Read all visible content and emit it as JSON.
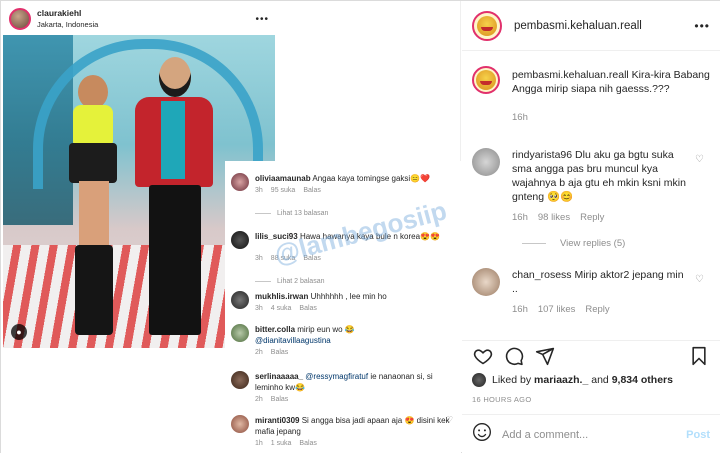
{
  "inner_post": {
    "username": "claurakiehl",
    "location": "Jakarta, Indonesia",
    "comments": [
      {
        "user": "oliviaamaunab",
        "text": "Angaa kaya tomingse gaksi😑❤️",
        "time": "3h",
        "likes": "95 suka",
        "reply": "Balas"
      },
      {
        "more": "Lihat 13 balasan"
      },
      {
        "user": "lilis_suci93",
        "text": "Hawa hawanya kaya bule n korea😍😍",
        "time": "3h",
        "likes": "88 suka",
        "reply": "Balas"
      },
      {
        "more": "Lihat 2 balasan"
      },
      {
        "user": "mukhlis.irwan",
        "text": "Uhhhhhh , lee min ho",
        "time": "3h",
        "likes": "4 suka",
        "reply": "Balas"
      },
      {
        "user": "bitter.colla",
        "text": "mirip eun wo 😂",
        "mention": "@dianitavillaagustina",
        "time": "2h",
        "reply": "Balas"
      },
      {
        "user": "serlinaaaaa_",
        "mention": "@ressymagfiratuf",
        "text": "ie nanaonan si, si leminho kw😂",
        "time": "2h",
        "reply": "Balas"
      },
      {
        "user": "miranti0309",
        "text": "Si angga bisa jadi apaan aja 😍 disini kek mafia jepang",
        "time": "1h",
        "likes": "1 suka",
        "reply": "Balas"
      }
    ],
    "watermark": "@lambegosiip"
  },
  "post": {
    "username": "pembasmi.kehaluan.reall",
    "caption_user": "pembasmi.kehaluan.reall",
    "caption": "Kira-kira Babang Angga mirip siapa nih gaesss.???",
    "caption_time": "16h",
    "comments": [
      {
        "user": "rindyarista96",
        "text": "Dlu aku ga bgtu suka sma angga pas bru muncul kya wajahnya b aja gtu eh mkin ksni mkin gnteng 🥺😊",
        "time": "16h",
        "likes": "98 likes",
        "reply": "Reply",
        "view_replies": "View replies (5)"
      },
      {
        "user": "chan_rosess",
        "text": "Mirip aktor2 jepang min ..",
        "time": "16h",
        "likes": "107 likes",
        "reply": "Reply"
      }
    ],
    "liked_by_prefix": "Liked by",
    "liked_by_user": "mariaazh._",
    "liked_by_suffix": "and",
    "liked_by_others": "9,834 others",
    "time_ago": "16 HOURS AGO",
    "add_comment_placeholder": "Add a comment...",
    "post_label": "Post"
  },
  "colors": {
    "accent_link": "#00376b",
    "post_button": "#b2dffc",
    "story_ring": "#e1306c"
  },
  "icons": [
    "heart-icon",
    "comment-icon",
    "share-icon",
    "bookmark-icon",
    "emoji-icon",
    "more-icon"
  ]
}
